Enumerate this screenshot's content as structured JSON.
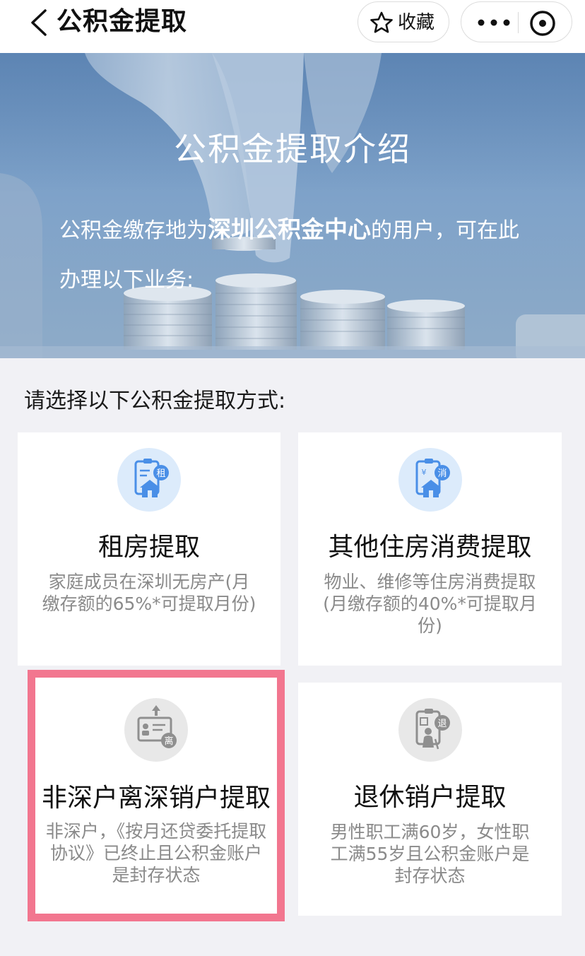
{
  "nav": {
    "title": "公积金提取",
    "favorite_label": "收藏"
  },
  "banner": {
    "title": "公积金提取介绍",
    "text_before": "公积金缴存地为",
    "text_highlight": "深圳公积金中心",
    "text_after": "的用户，可在此办理以下业务:"
  },
  "section": {
    "label": "请选择以下公积金提取方式:"
  },
  "cards": [
    {
      "title": "租房提取",
      "description": "家庭成员在深圳无房产(月缴存额的65%*可提取月份)",
      "icon_badge": "租",
      "icon": "rent-house-icon",
      "style": "active"
    },
    {
      "title": "其他住房消费提取",
      "description": "物业、维修等住房消费提取(月缴存额的40%*可提取月份)",
      "icon_badge": "消",
      "icon": "housing-consumption-icon",
      "style": "active"
    },
    {
      "title": "非深户离深销户提取",
      "description": "非深户，《按月还贷委托提取协议》已终止且公积金账户是封存状态",
      "icon_badge": "离",
      "icon": "account-leave-icon",
      "style": "disabled"
    },
    {
      "title": "退休销户提取",
      "description": "男性职工满60岁，女性职工满55岁且公积金账户是封存状态",
      "icon_badge": "退",
      "icon": "retirement-icon",
      "style": "disabled"
    }
  ],
  "colors": {
    "accent_blue": "#4a8fe7",
    "icon_bg_blue": "#dcebfb",
    "icon_bg_gray": "#e8e8e8",
    "highlight_border": "#f2768f",
    "desc_gray": "#8a8a8a"
  }
}
